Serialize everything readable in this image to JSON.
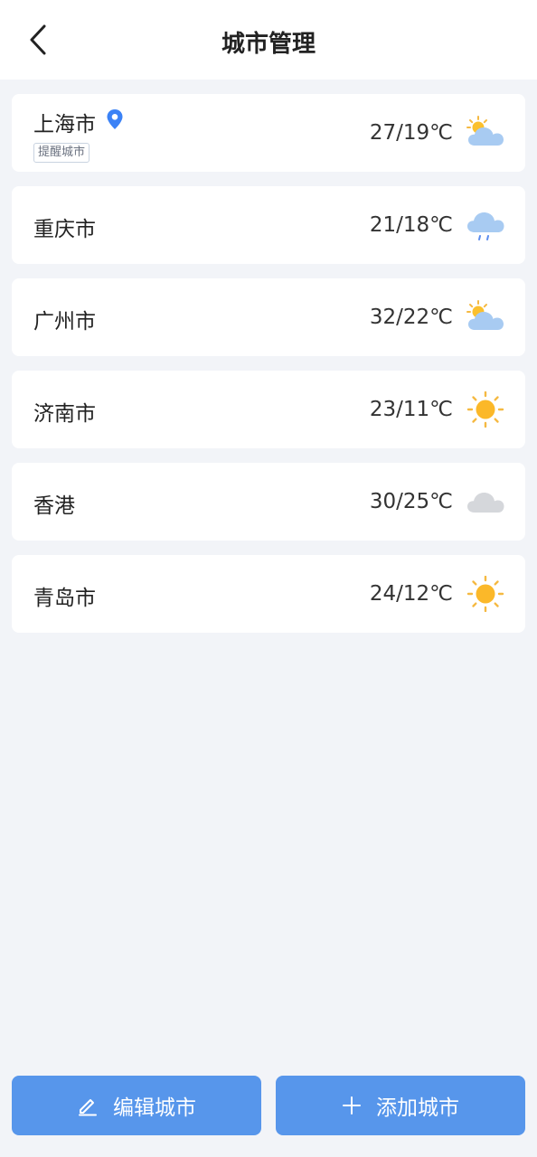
{
  "header": {
    "title": "城市管理",
    "back_icon": "chevron-left-icon"
  },
  "cities": [
    {
      "name": "上海市",
      "tag": "提醒城市",
      "location_icon": "location-pin-icon",
      "temp": "27/19℃",
      "icon": "partly-cloudy-icon"
    },
    {
      "name": "重庆市",
      "temp": "21/18℃",
      "icon": "light-rain-icon"
    },
    {
      "name": "广州市",
      "temp": "32/22℃",
      "icon": "partly-cloudy-icon"
    },
    {
      "name": "济南市",
      "temp": "23/11℃",
      "icon": "sunny-icon"
    },
    {
      "name": "香港",
      "temp": "30/25℃",
      "icon": "cloudy-icon"
    },
    {
      "name": "青岛市",
      "temp": "24/12℃",
      "icon": "sunny-icon"
    }
  ],
  "footer": {
    "edit_label": "编辑城市",
    "edit_icon": "pencil-icon",
    "add_label": "添加城市",
    "add_icon": "plus-icon"
  },
  "colors": {
    "accent": "#5796eb",
    "background": "#f2f4f8",
    "location_pin": "#3b82f6"
  }
}
